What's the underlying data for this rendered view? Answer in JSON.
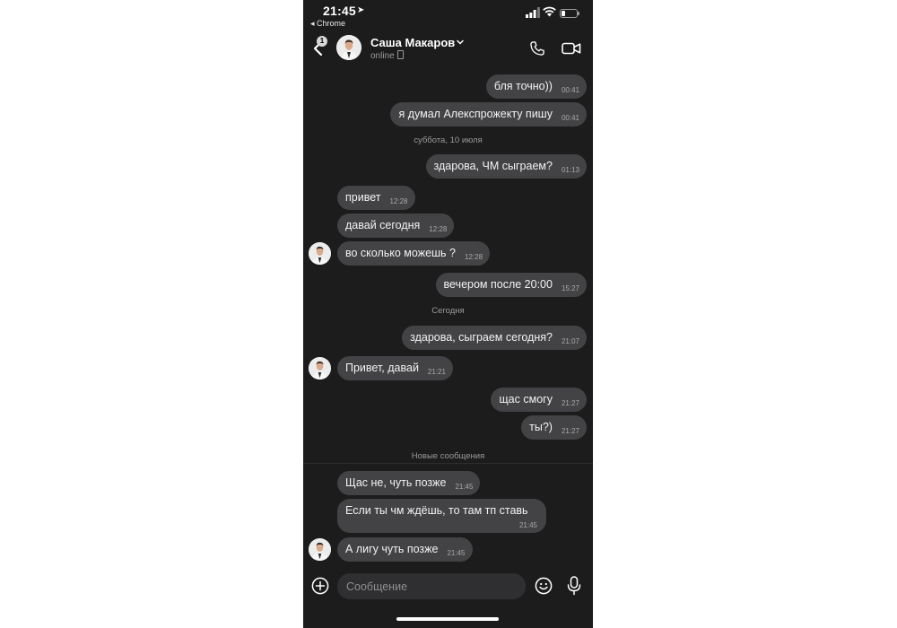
{
  "status_bar": {
    "time": "21:45",
    "back_app": "◂ Chrome",
    "battery_level": 0.25
  },
  "header": {
    "badge_count": "1",
    "contact_name": "Саша Макаров",
    "contact_status": "online",
    "icons": [
      "chevron-left-icon",
      "chevron-down-icon",
      "phone-icon",
      "video-camera-icon"
    ]
  },
  "date_separators": {
    "saturday": "суббота, 10 июля",
    "today": "Сегодня",
    "new_messages": "Новые сообщения"
  },
  "messages": [
    {
      "dir": "out",
      "text": "бля точно))",
      "time": "00:41"
    },
    {
      "dir": "out",
      "text": "я думал Алекспрожекту пишу",
      "time": "00:41"
    },
    {
      "dir": "out",
      "text": "здарова, ЧМ сыграем?",
      "time": "01:13"
    },
    {
      "dir": "in",
      "text": "привет",
      "time": "12:28"
    },
    {
      "dir": "in",
      "text": "давай сегодня",
      "time": "12:28"
    },
    {
      "dir": "in",
      "text": "во сколько можешь ?",
      "time": "12:28"
    },
    {
      "dir": "out",
      "text": "вечером после 20:00",
      "time": "15:27"
    },
    {
      "dir": "out",
      "text": "здарова, сыграем сегодня?",
      "time": "21:07"
    },
    {
      "dir": "in",
      "text": "Привет, давай",
      "time": "21:21"
    },
    {
      "dir": "out",
      "text": "щас смогу",
      "time": "21:27"
    },
    {
      "dir": "out",
      "text": "ты?)",
      "time": "21:27"
    },
    {
      "dir": "in",
      "text": "Щас не, чуть позже",
      "time": "21:45"
    },
    {
      "dir": "in",
      "text": "Если ты чм ждёшь, то там тп ставь",
      "time": "21:45"
    },
    {
      "dir": "in",
      "text": "А лигу чуть позже",
      "time": "21:45"
    }
  ],
  "input_bar": {
    "placeholder": "Сообщение",
    "icons": [
      "plus-circle-icon",
      "emoji-icon",
      "microphone-icon"
    ]
  },
  "colors": {
    "background": "#1c1c1d",
    "bubble": "#434345",
    "input": "#2f2f31",
    "muted_text": "#9a9a9a"
  }
}
